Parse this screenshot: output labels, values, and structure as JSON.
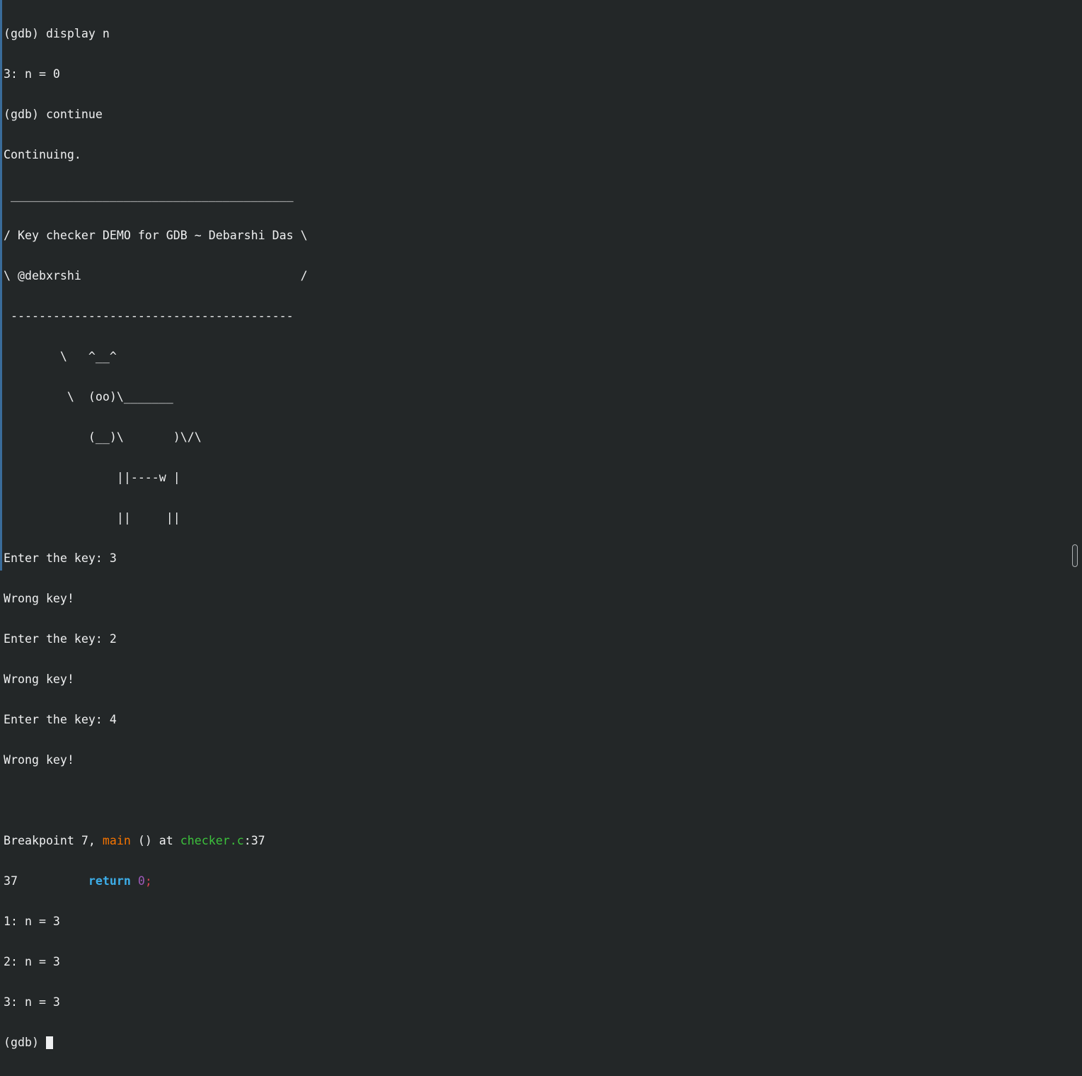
{
  "terminal": {
    "lines": [
      "(gdb) display n",
      "3: n = 0",
      "(gdb) continue",
      "Continuing.",
      " ________________________________________",
      "/ Key checker DEMO for GDB ~ Debarshi Das \\",
      "\\ @debxrshi                               /",
      " ----------------------------------------",
      "        \\   ^__^",
      "         \\  (oo)\\_______",
      "            (__)\\       )\\/\\",
      "                ||----w |",
      "                ||     ||",
      "Enter the key: 3",
      "Wrong key!",
      "Enter the key: 2",
      "Wrong key!",
      "Enter the key: 4",
      "Wrong key!",
      ""
    ],
    "breakpoint": {
      "prefix": "Breakpoint 7, ",
      "function": "main",
      "middle": " () at ",
      "file": "checker.c",
      "suffix": ":37"
    },
    "source": {
      "line_no": "37",
      "indent": "          ",
      "keyword": "return",
      "space": " ",
      "value": "0",
      "semicolon": ";"
    },
    "displays": [
      "1: n = 3",
      "2: n = 3",
      "3: n = 3"
    ],
    "prompt": "(gdb) ",
    "colors": {
      "background": "#232728",
      "foreground": "#eff0f1",
      "function": "#f67400",
      "file": "#3cc13c",
      "keyword": "#3daee9",
      "number": "#9b59b6",
      "punctuation": "#da4453"
    },
    "scrollbar_icon": "scrollbar-handle"
  }
}
